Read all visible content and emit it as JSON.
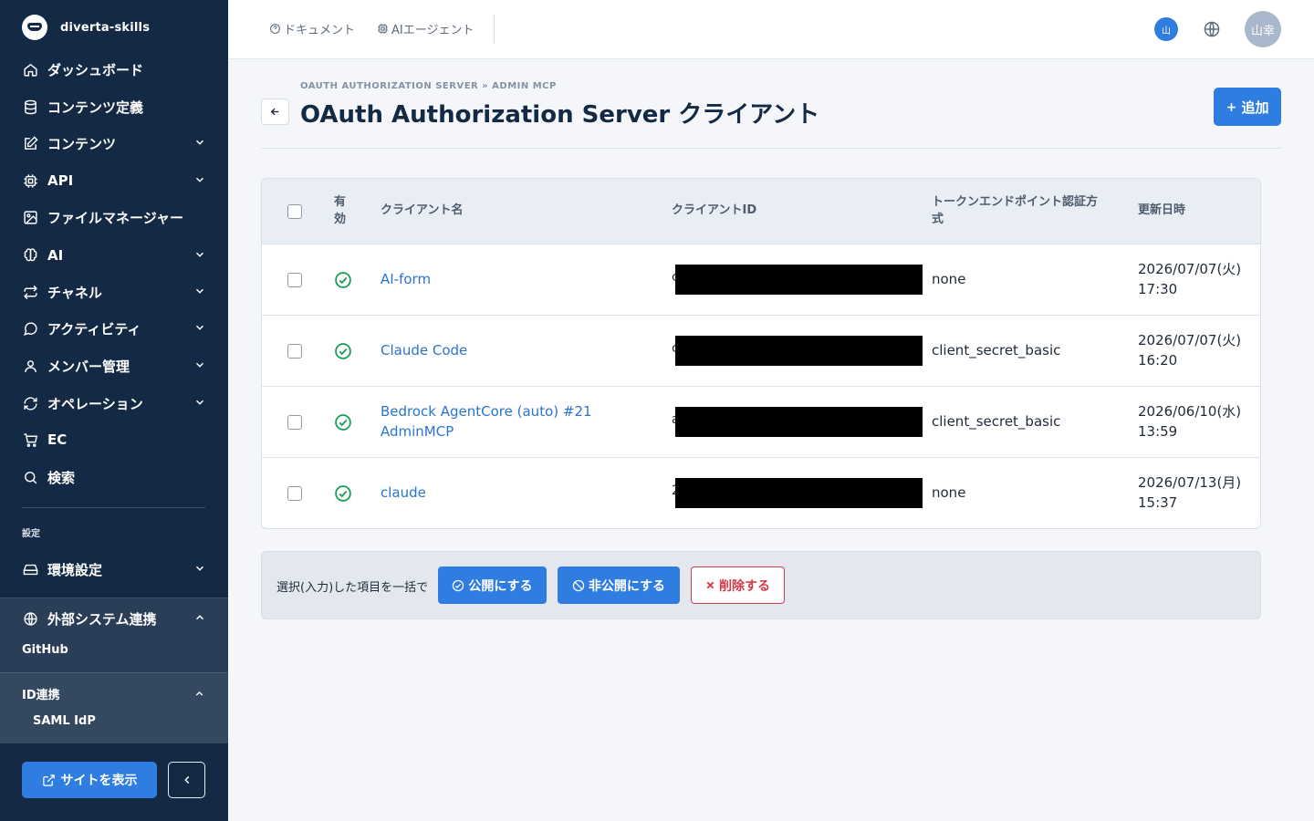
{
  "sidebar": {
    "brand": "diverta-skills",
    "items": [
      {
        "label": "ダッシュボード",
        "icon": "home-icon"
      },
      {
        "label": "コンテンツ定義",
        "icon": "database-icon"
      },
      {
        "label": "コンテンツ",
        "icon": "edit-icon"
      },
      {
        "label": "API",
        "icon": "cpu-icon"
      },
      {
        "label": "ファイルマネージャー",
        "icon": "image-icon"
      },
      {
        "label": "AI",
        "icon": "brain-icon"
      },
      {
        "label": "チャネル",
        "icon": "repeat-icon"
      },
      {
        "label": "アクティビティ",
        "icon": "message-icon"
      },
      {
        "label": "メンバー管理",
        "icon": "user-icon"
      },
      {
        "label": "オペレーション",
        "icon": "refresh-icon"
      },
      {
        "label": "EC",
        "icon": "cart-icon"
      },
      {
        "label": "検索",
        "icon": "search-icon"
      }
    ],
    "settings_heading": "設定",
    "env_settings": "環境設定",
    "external": {
      "label": "外部システム連携",
      "github": "GitHub",
      "id_linkage": "ID連携",
      "saml": "SAML IdP"
    },
    "view_site": "サイトを表示"
  },
  "topbar": {
    "docs": "ドキュメント",
    "ai_agent": "AIエージェント",
    "lang_badge": "山",
    "avatar": "山幸"
  },
  "page": {
    "breadcrumb": "OAUTH AUTHORIZATION SERVER » ADMIN MCP",
    "title": "OAuth Authorization Server クライアント",
    "add_label": "追加"
  },
  "table": {
    "headers": {
      "enabled": "有効",
      "client_name": "クライアント名",
      "client_id": "クライアントID",
      "auth_method": "トークンエンドポイント認証方式",
      "updated": "更新日時"
    },
    "rows": [
      {
        "name": "AI-form",
        "id_prefix": "c",
        "auth": "none",
        "date": "2026/07/07(火)",
        "time": "17:30"
      },
      {
        "name": "Claude Code",
        "id_prefix": "c",
        "auth": "client_secret_basic",
        "date": "2026/07/07(火)",
        "time": "16:20"
      },
      {
        "name": "Bedrock AgentCore (auto) #21 AdminMCP",
        "id_prefix": "a",
        "auth": "client_secret_basic",
        "date": "2026/06/10(水)",
        "time": "13:59"
      },
      {
        "name": "claude",
        "id_prefix": "2",
        "auth": "none",
        "date": "2026/07/13(月)",
        "time": "15:37"
      }
    ]
  },
  "bulk": {
    "label": "選択(入力)した項目を一括で",
    "publish": "公開にする",
    "unpublish": "非公開にする",
    "delete": "削除する"
  },
  "colors": {
    "sidebar_bg": "#142a44",
    "accent": "#2f7de1",
    "success": "#1e9e5a",
    "danger": "#d73a49"
  }
}
